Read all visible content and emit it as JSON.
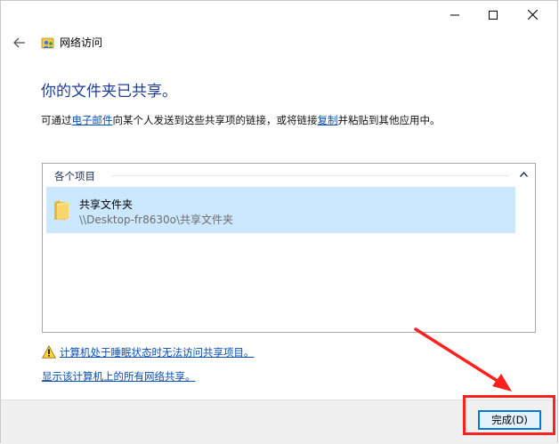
{
  "window": {
    "title": "网络访问"
  },
  "main": {
    "heading": "你的文件夹已共享。",
    "description": {
      "part1": "可通过",
      "link_email": "电子邮件",
      "part2": "向某个人发送到这些共享项的链接，或将链接",
      "link_copy": "复制",
      "part3": "并粘贴到其他应用中。"
    }
  },
  "list": {
    "group_header": "各个项目",
    "items": [
      {
        "name": "共享文件夹",
        "path": "\\\\Desktop-fr8630o\\共享文件夹"
      }
    ]
  },
  "footer": {
    "warning_link": "计算机处于睡眠状态时无法访问共享项目。",
    "show_shares_link": "显示该计算机上的所有网络共享。",
    "done_button": "完成(D)"
  },
  "icons": {
    "back": "back-arrow-icon",
    "app": "network-users-icon",
    "folder": "folder-icon",
    "warning": "warning-icon",
    "chevron": "chevron-up-icon"
  },
  "colors": {
    "heading": "#1f3d99",
    "link": "#0a4fb3",
    "selection": "#cce8ff",
    "annotation": "#ff2020"
  }
}
